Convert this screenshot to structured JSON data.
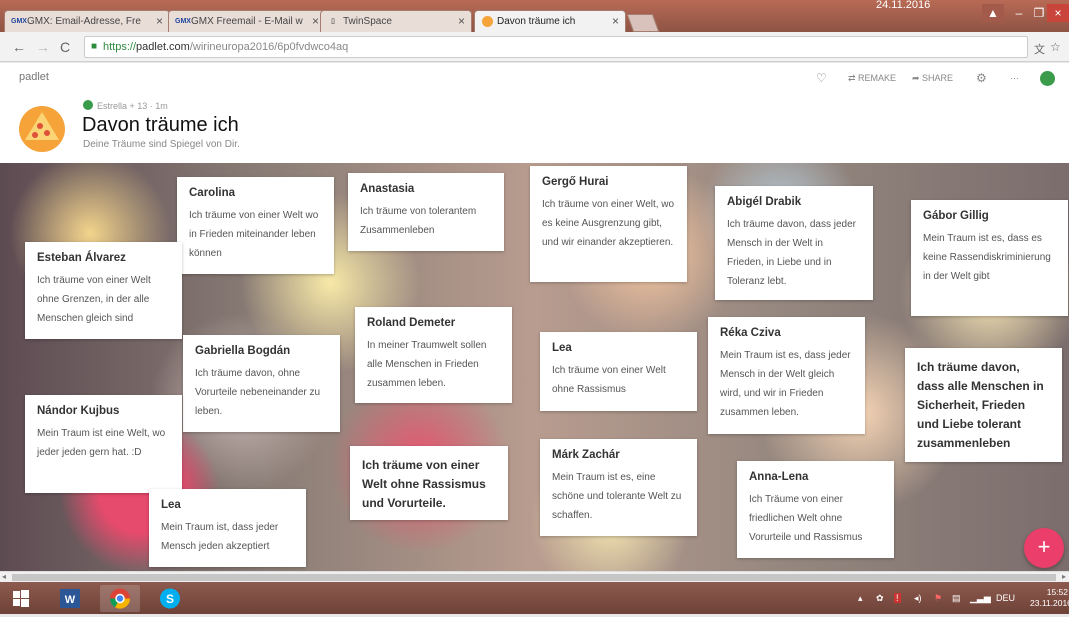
{
  "browser": {
    "datebox": "24.11.2016",
    "tabs": [
      {
        "icon": "gmx",
        "label": "GMX: Email-Adresse, Fre"
      },
      {
        "icon": "gmx",
        "label": "GMX Freemail - E-Mail w"
      },
      {
        "icon": "doc",
        "label": "TwinSpace"
      },
      {
        "icon": "padlet",
        "label": "Davon träume ich"
      }
    ],
    "icon_labels": {
      "gmx": "GMX"
    },
    "url_https": "https://",
    "url_host": "padlet.com",
    "url_path": "/wirineuropa2016/6p0fvdwco4aq"
  },
  "header": {
    "brand": "padlet",
    "remake": "REMAKE",
    "share": "SHARE",
    "more": "···",
    "meta": "Estrella + 13  ·  1m",
    "title": "Davon träume ich",
    "subtitle": "Deine Träume sind Spiegel von Dir."
  },
  "posts": [
    {
      "author": "Carolina",
      "text": "Ich träume von einer Welt wo in Frieden miteinander leben können"
    },
    {
      "author": "Anastasia",
      "text": "Ich träume von tolerantem Zusammenleben"
    },
    {
      "author": "Gergő Hurai",
      "text": "Ich träume von einer Welt, wo es keine Ausgrenzung gibt, und wir einander akzeptieren."
    },
    {
      "author": "Abigél Drabik",
      "text": "Ich träume davon, dass jeder Mensch in der Welt in Frieden, in Liebe und in Toleranz lebt."
    },
    {
      "author": "Gábor Gillig",
      "text": "Mein Traum ist es, dass es keine Rassendiskriminierung in der Welt gibt"
    },
    {
      "author": "Esteban Álvarez",
      "text": "Ich träume von einer Welt ohne Grenzen, in der alle Menschen gleich sind"
    },
    {
      "author": "Roland Demeter",
      "text": "In meiner Traumwelt sollen alle Menschen in Frieden zusammen leben."
    },
    {
      "author": "Réka Cziva",
      "text": "Mein Traum ist es, dass jeder Mensch in der Welt gleich wird, und wir in Frieden zusammen leben."
    },
    {
      "author": "Gabriella Bogdán",
      "text": "Ich träume davon, ohne Vorurteile nebeneinander zu leben."
    },
    {
      "author": "Lea",
      "text": "Ich träume von einer Welt ohne Rassismus"
    },
    {
      "author": "",
      "text": "Ich träume davon, dass alle Menschen in Sicherheit, Frieden und Liebe tolerant zusammenleben"
    },
    {
      "author": "Nándor Kujbus",
      "text": "Mein Traum ist eine Welt, wo jeder jeden gern hat. :D"
    },
    {
      "author": "",
      "text": "Ich träume von einer Welt ohne Rassismus und Vorurteile."
    },
    {
      "author": "Márk Zachár",
      "text": "Mein Traum ist es,  eine schöne und tolerante Welt zu schaffen."
    },
    {
      "author": "Anna-Lena",
      "text": "Ich Träume von einer friedlichen Welt ohne Vorurteile und Rassismus"
    },
    {
      "author": "Lea",
      "text": "Mein Traum ist, dass jeder Mensch jeden akzeptiert"
    }
  ],
  "fab": "+",
  "taskbar": {
    "lang": "DEU",
    "time": "15:52",
    "date": "23.11.2016"
  }
}
